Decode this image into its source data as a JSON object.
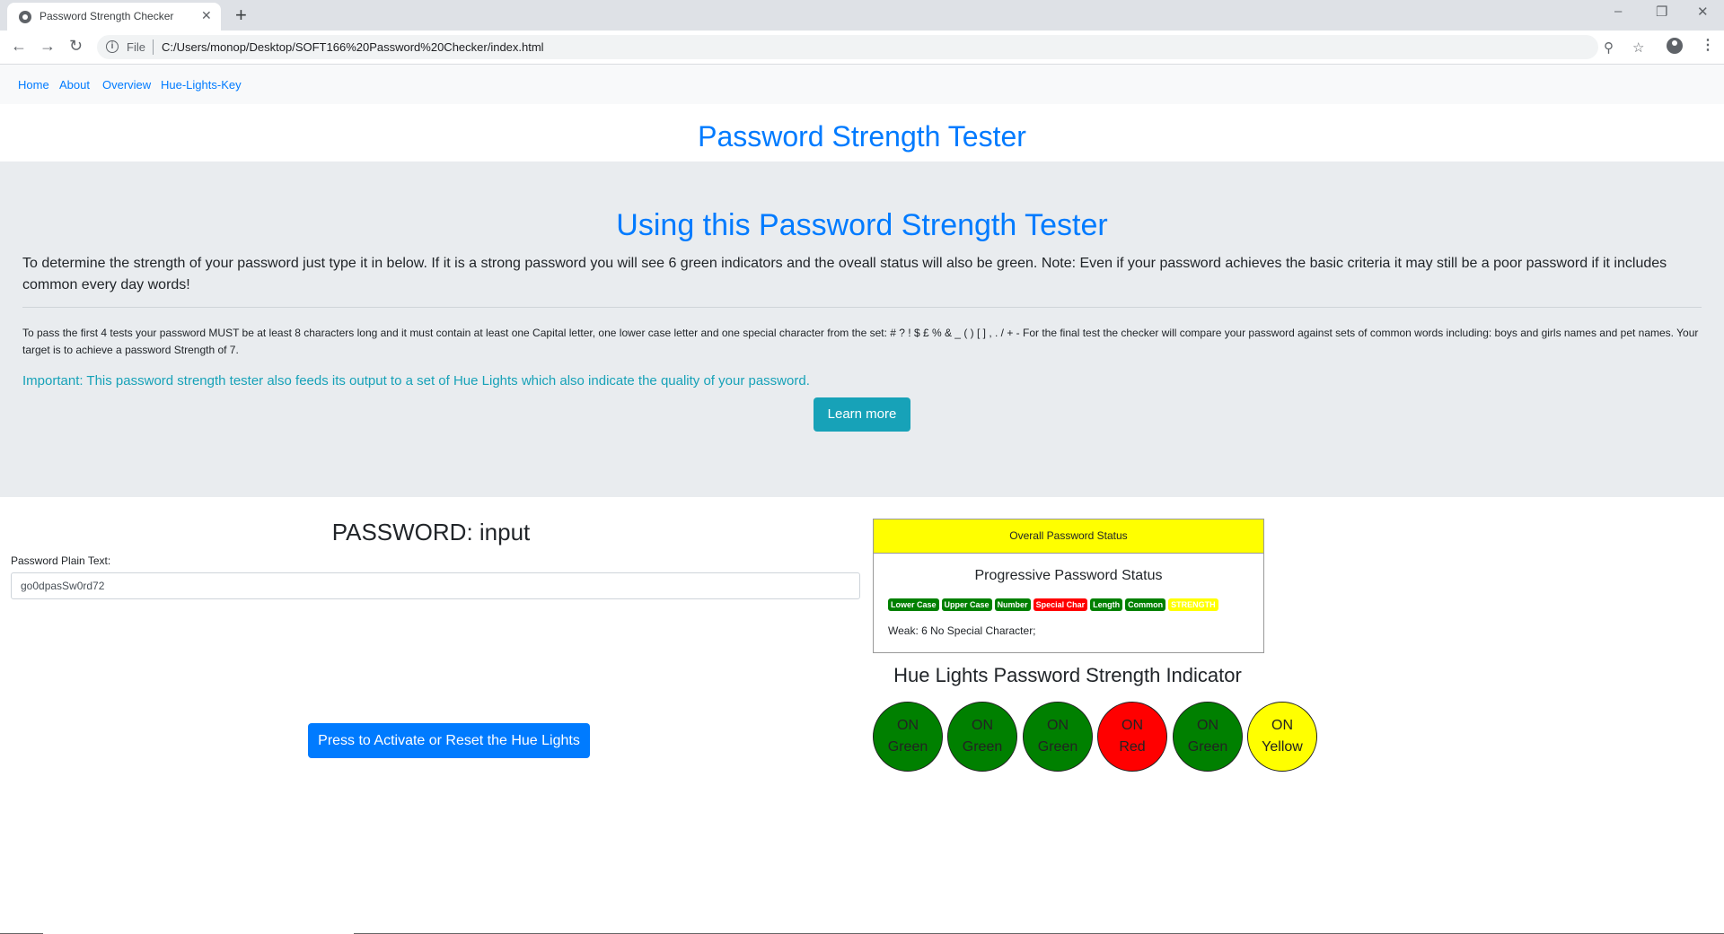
{
  "browser": {
    "tab_title": "Password Strength Checker",
    "tab_close": "✕",
    "new_tab": "+",
    "file_label": "File",
    "url": "C:/Users/monop/Desktop/SOFT166%20Password%20Checker/index.html"
  },
  "nav": {
    "links": [
      "Home",
      "About",
      "Overview",
      "Hue-Lights-Key"
    ]
  },
  "page_title": "Password Strength Tester",
  "jumbotron": {
    "title": "Using this Password Strength Tester",
    "lead": "To determine the strength of your password just type it in below. If it is a strong password you will see 6 green indicators and the oveall status will also be green. Note: Even if your password achieves the basic criteria it may still be a poor password if it includes common every day words!",
    "criteria": "To pass the first 4 tests your password MUST be at least 8 characters long and it must contain at least one Capital letter, one lower case letter and one special character from the set: # ? ! $ £ % & _ ( ) [ ] , . / + - For the final test the checker will compare your password against sets of common words including: boys and girls names and pet names. Your target is to achieve a password Strength of 7.",
    "important": "Important: This password strength tester also feeds its output to a set of Hue Lights which also indicate the quality of your password.",
    "learn_more": "Learn more"
  },
  "password": {
    "heading": "PASSWORD: input",
    "label": "Password Plain Text:",
    "value": "go0dpasSw0rd72"
  },
  "hue_button": "Press to Activate or Reset the Hue Lights",
  "status": {
    "header": "Overall Password Status",
    "header_color": "#ffff00",
    "progressive_title": "Progressive Password Status",
    "badges": [
      {
        "label": "Lower Case",
        "color": "#008000"
      },
      {
        "label": "Upper Case",
        "color": "#008000"
      },
      {
        "label": "Number",
        "color": "#008000"
      },
      {
        "label": "Special Char",
        "color": "#ff0000"
      },
      {
        "label": "Length",
        "color": "#008000"
      },
      {
        "label": "Common",
        "color": "#008000"
      },
      {
        "label": "STRENGTH",
        "color": "#ffff00"
      }
    ],
    "message": "Weak: 6 No Special Character;"
  },
  "hue_lights": {
    "title": "Hue Lights Password Strength Indicator",
    "lights": [
      {
        "state": "ON",
        "color_name": "Green",
        "color": "#008000"
      },
      {
        "state": "ON",
        "color_name": "Green",
        "color": "#008000"
      },
      {
        "state": "ON",
        "color_name": "Green",
        "color": "#008000"
      },
      {
        "state": "ON",
        "color_name": "Red",
        "color": "#ff0000"
      },
      {
        "state": "ON",
        "color_name": "Green",
        "color": "#008000"
      },
      {
        "state": "ON",
        "color_name": "Yellow",
        "color": "#ffff00"
      }
    ]
  }
}
